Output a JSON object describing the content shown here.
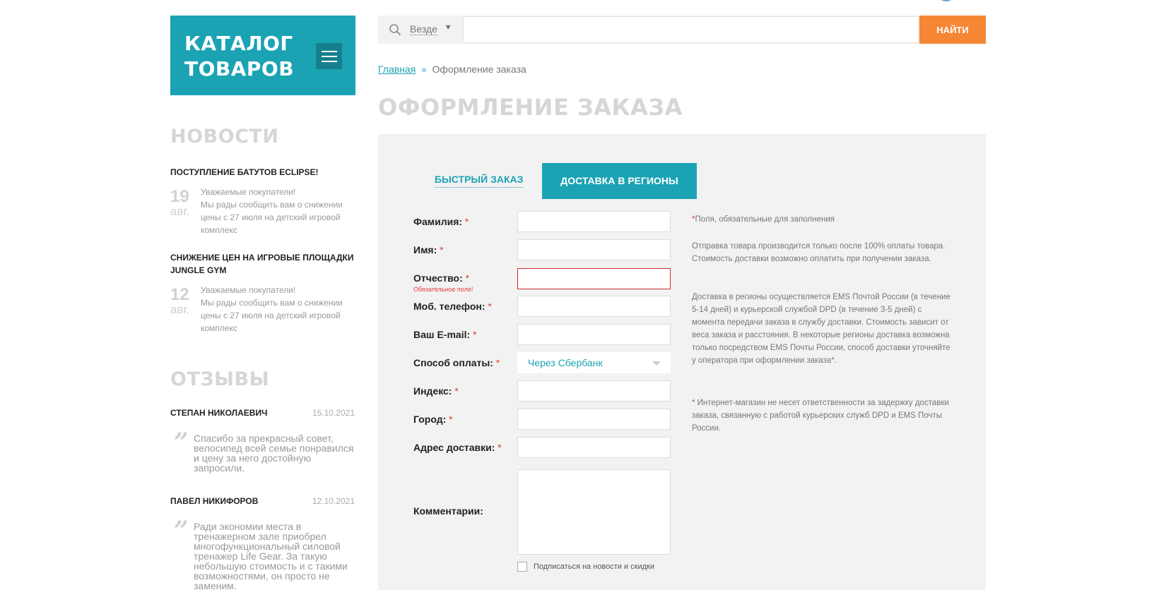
{
  "catalog": {
    "title": "КАТАЛОГ\nТОВАРОВ"
  },
  "search": {
    "scope": "Везде",
    "placeholder": "",
    "button": "НАЙТИ"
  },
  "breadcrumb": {
    "home": "Главная",
    "current": "Оформление заказа"
  },
  "page_title": "ОФОРМЛЕНИЕ ЗАКАЗА",
  "news": {
    "heading": "НОВОСТИ",
    "items": [
      {
        "title": "ПОСТУПЛЕНИЕ БАТУТОВ ECLIPSE!",
        "day": "19",
        "month": "авг.",
        "text": "Уважаемые покупатели!\nМы рады сообщить вам о снижении цены с 27 июля на детский игровой комплекс"
      },
      {
        "title": "СНИЖЕНИЕ ЦЕН НА ИГРОВЫЕ ПЛОЩАДКИ JUNGLE GYM",
        "day": "12",
        "month": "авг.",
        "text": "Уважаемые покупатели!\nМы рады сообщить вам о снижении цены с 27 июля на детский игровой комплекс"
      }
    ]
  },
  "reviews": {
    "heading": "ОТЗЫВЫ",
    "items": [
      {
        "author": "СТЕПАН НИКОЛАЕВИЧ",
        "date": "15.10.2021",
        "text": "Спасибо за прекрасный совет, велосипед всей семье понравился и цену за него достойную запросили."
      },
      {
        "author": "ПАВЕЛ НИКИФОРОВ",
        "date": "12.10.2021",
        "text": "Ради экономии места в тренажерном зале приобрел многофункциональный силовой тренажер Life Gear. За такую небольшую стоимость и с такими возможностями, он просто не заменим."
      }
    ]
  },
  "order": {
    "tabs": {
      "quick": "БЫСТРЫЙ ЗАКАЗ",
      "regions": "ДОСТАВКА В РЕГИОНЫ"
    },
    "required_mark": "*",
    "fields": {
      "lastname": "Фамилия:",
      "firstname": "Имя:",
      "patronymic": "Отчество:",
      "patronymic_error": "Обязательное поле!",
      "phone": "Моб. телефон:",
      "email": "Ваш E-mail:",
      "payment": "Способ оплаты:",
      "payment_value": "Через Сбербанк",
      "index": "Индекс:",
      "city": "Город:",
      "address": "Адрес доставки:",
      "comments": "Комментарии:"
    },
    "subscribe": "Подписаться на новости и скидки",
    "info": {
      "required_note": "Поля, обязательные для заполнения",
      "p1": "Отправка товара производится только после 100% оплаты товара. Стоимость доставки возможно оплатить при получении заказа.",
      "p2": "Доставка в регионы осуществляется EMS Почтой России (в течение 5-14 дней) и курьерской службой DPD (в течение 3-5 дней) с момента передачи заказа в службу доставки. Стоимость зависит от веса заказа и расстояния. В некоторые регионы доставка возможна только посредством EMS Почты России, способ доставки уточняйте у оператора при оформлении заказа*.",
      "p3": "* Интернет-магазин не несет ответственности за задержку доставки заказа, связанную с работой курьерских служб DPD и EMS Почты России."
    }
  },
  "colors": {
    "accent": "#1ba3b4",
    "button": "#f58634",
    "error": "#e53935",
    "panel": "#f2f2f2"
  },
  "icons": {
    "search": "search-icon",
    "menu": "menu-icon",
    "quote": "quote-icon",
    "chevron": "double-chevron-icon"
  }
}
